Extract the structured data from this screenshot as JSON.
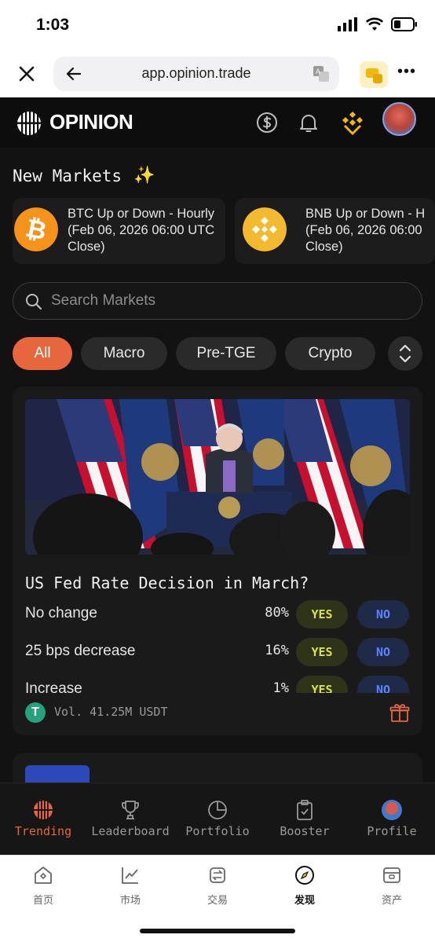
{
  "status_bar": {
    "time": "1:03"
  },
  "browser": {
    "url": "app.opinion.trade"
  },
  "header": {
    "logo": "OPINION"
  },
  "new_markets": {
    "title": "New Markets",
    "items": [
      {
        "coin": "btc",
        "text": "BTC Up or Down - Hourly\n(Feb 06, 2026 06:00 UTC\nClose)"
      },
      {
        "coin": "bnb",
        "text": "BNB Up or Down - H\n(Feb 06, 2026 06:00\nClose)"
      }
    ]
  },
  "search": {
    "placeholder": "Search Markets"
  },
  "filters": [
    "All",
    "Macro",
    "Pre-TGE",
    "Crypto"
  ],
  "market": {
    "title": "US Fed Rate Decision in March?",
    "outcomes": [
      {
        "label": "No change",
        "pct": "80%"
      },
      {
        "label": "25 bps decrease",
        "pct": "16%"
      },
      {
        "label": "Increase",
        "pct": "1%"
      }
    ],
    "yes_label": "YES",
    "no_label": "NO",
    "volume": "Vol. 41.25M USDT",
    "tether_symbol": "T"
  },
  "app_nav": [
    "Trending",
    "Leaderboard",
    "Portfolio",
    "Booster",
    "Profile"
  ],
  "tabbar": [
    "首页",
    "市场",
    "交易",
    "发现",
    "资产"
  ],
  "colors": {
    "accent": "#e8663e",
    "yes": "#d8e24a",
    "no": "#5b82ff",
    "bg": "#121212"
  }
}
